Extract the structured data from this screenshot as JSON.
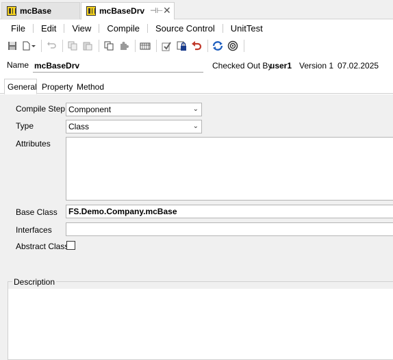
{
  "doc_tabs": [
    {
      "label": "mcBase"
    },
    {
      "label": "mcBaseDrv"
    }
  ],
  "menu": [
    "File",
    "Edit",
    "View",
    "Compile",
    "Source Control",
    "UnitTest"
  ],
  "header": {
    "name_label": "Name",
    "name_value": "mcBaseDrv",
    "checked_out_label": "Checked Out By",
    "checked_out_user": "user1",
    "version_label": "Version 1",
    "date": "07.02.2025"
  },
  "prop_tabs": [
    "General",
    "Property",
    "Method"
  ],
  "form": {
    "compile_step_label": "Compile Step",
    "compile_step_value": "Component",
    "type_label": "Type",
    "type_value": "Class",
    "attributes_label": "Attributes",
    "base_class_label": "Base Class",
    "base_class_value": "FS.Demo.Company.mcBase",
    "interfaces_label": "Interfaces",
    "abstract_label": "Abstract Class",
    "description_label": "Description"
  },
  "colors": {
    "accent_blue": "#1f5fbf",
    "undo_red": "#c0392b",
    "lock_blue": "#1a3c8c"
  }
}
